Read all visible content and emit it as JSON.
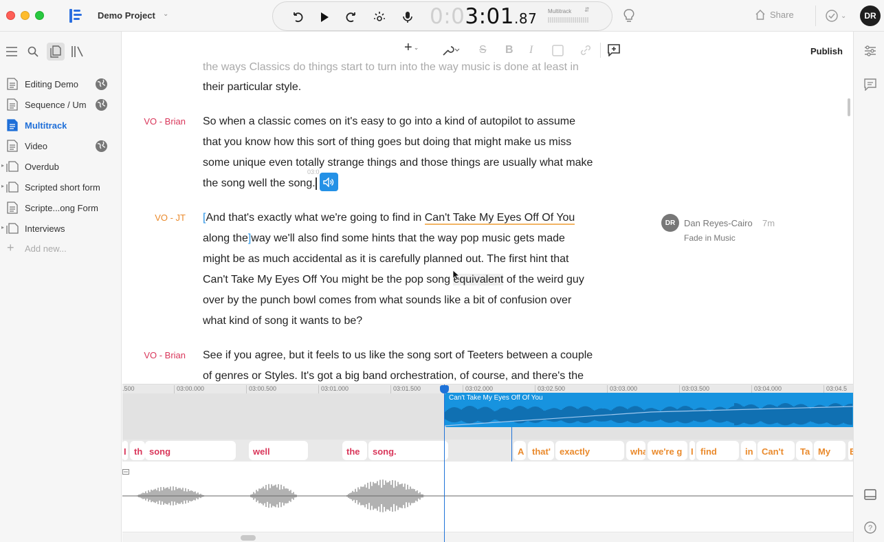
{
  "titlebar": {
    "project_name": "Demo Project",
    "time_dim": "0:0",
    "time_main": "3:01",
    "time_ms": ".87",
    "track_select": "Multitrack",
    "share_label": "Share",
    "avatar_initials": "DR"
  },
  "sidebar": {
    "items": [
      {
        "label": "Editing Demo",
        "kind": "doc",
        "globe": true
      },
      {
        "label": "Sequence / Um",
        "kind": "doc",
        "globe": true
      },
      {
        "label": "Multitrack",
        "kind": "doc",
        "active": true
      },
      {
        "label": "Video",
        "kind": "doc",
        "globe": true
      },
      {
        "label": "Overdub",
        "kind": "folder"
      },
      {
        "label": "Scripted short form",
        "kind": "folder"
      },
      {
        "label": "Scripte...ong Form",
        "kind": "doc"
      },
      {
        "label": "Interviews",
        "kind": "folder"
      }
    ],
    "add_new": "Add new..."
  },
  "toolbar": {
    "publish_label": "Publish"
  },
  "document": {
    "faded_line": "the ways Classics do things start to turn into the way music is done at least in",
    "p0_line": "their particular style.",
    "p1_speaker": "VO - Brian",
    "p1_lines": [
      "So when a classic comes on it's easy to go into a kind of autopilot to assume",
      "that you know how this sort of thing goes but doing that might make us miss",
      "some unique even totally strange things and those things are usually what make",
      "the song well the song."
    ],
    "small_timestamp": "03:0",
    "p2_speaker": "VO - JT",
    "p2_l1_a": "And that's exactly what we're going to find in ",
    "p2_l1_b": "Can't Take My Eyes Off Of You",
    "p2_l2_a": "along the",
    "p2_l2_b": "way we'll also find some hints that the way pop music gets made",
    "p2_l3": "might be as much accidental as it is carefully planned out. The first hint that",
    "p2_l4_a": "Can't Take My Eyes Off You might be the pop song ",
    "p2_l4_b": "equivalent",
    "p2_l4_c": " of the weird guy",
    "p2_l5": "over by the punch bowl comes from what sounds like a bit of confusion over",
    "p2_l6": "what kind of song it wants to be?",
    "p3_speaker": "VO - Brian",
    "p3_lines": [
      "See if you agree, but it feels to us like the song sort of Teeters between a couple",
      "of genres or Styles. It's got a big band orchestration, of course, and there's the"
    ]
  },
  "comment": {
    "initials": "DR",
    "author": "Dan Reyes-Cairo",
    "time": "7m",
    "text": "Fade in Music"
  },
  "timeline": {
    "ruler": [
      ".500",
      "03:00.000",
      "03:00.500",
      "03:01.000",
      "03:01.500",
      "03:02.000",
      "03:02.500",
      "03:03.000",
      "03:03.500",
      "03:04.000",
      "03:04.5"
    ],
    "clip_title": "Can't Take My Eyes Off Of You",
    "words": [
      {
        "t": "I",
        "s": "b"
      },
      {
        "t": "th",
        "s": "b"
      },
      {
        "t": "song",
        "s": "b"
      },
      {
        "t": "well",
        "s": "b"
      },
      {
        "t": "the",
        "s": "b"
      },
      {
        "t": "song.",
        "s": "b"
      },
      {
        "t": "A",
        "s": "j"
      },
      {
        "t": "that'",
        "s": "j"
      },
      {
        "t": "exactly",
        "s": "j"
      },
      {
        "t": "wha",
        "s": "j"
      },
      {
        "t": "we're g",
        "s": "j"
      },
      {
        "t": "I",
        "s": "j"
      },
      {
        "t": "find",
        "s": "j"
      },
      {
        "t": "in",
        "s": "j"
      },
      {
        "t": "Can't",
        "s": "j"
      },
      {
        "t": "Ta",
        "s": "j"
      },
      {
        "t": "My",
        "s": "j"
      },
      {
        "t": "E",
        "s": "j"
      }
    ]
  },
  "colors": {
    "accent": "#2491e6",
    "speaker_brian": "#d9365a",
    "speaker_jt": "#ea8a2c",
    "playhead": "#1e72d8"
  }
}
